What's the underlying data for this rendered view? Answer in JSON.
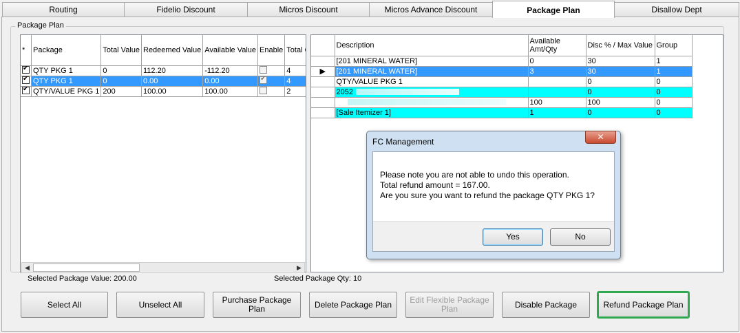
{
  "tabs": [
    {
      "label": "Routing"
    },
    {
      "label": "Fidelio Discount"
    },
    {
      "label": "Micros Discount"
    },
    {
      "label": "Micros Advance Discount"
    },
    {
      "label": "Package Plan"
    },
    {
      "label": "Disallow Dept"
    }
  ],
  "active_tab": "Package Plan",
  "groupbox_label": "Package Plan",
  "package_grid": {
    "headers": [
      "*",
      "Package",
      "Total Value",
      "Redeemed Value",
      "Available Value",
      "Enable",
      "Total Qty"
    ],
    "rows": [
      {
        "checked": true,
        "package": "QTY PKG 1",
        "total_value": "0",
        "redeemed_value": "112.20",
        "available_value": "-112.20",
        "enable": false,
        "total_qty": "4"
      },
      {
        "checked": true,
        "package": "QTY PKG 1",
        "total_value": "0",
        "redeemed_value": "0.00",
        "available_value": "0.00",
        "enable": true,
        "total_qty": "4"
      },
      {
        "checked": true,
        "package": "QTY/VALUE PKG 1",
        "total_value": "200",
        "redeemed_value": "100.00",
        "available_value": "100.00",
        "enable": false,
        "total_qty": "2"
      }
    ]
  },
  "detail_grid": {
    "headers": [
      "",
      "Description",
      "Available Amt/Qty",
      "Disc % / Max Value",
      "Group"
    ],
    "rows": [
      {
        "description": "[201 MINERAL WATER]",
        "available": "0",
        "disc": "30",
        "group": "1"
      },
      {
        "description": "[201 MINERAL WATER]",
        "available": "3",
        "disc": "30",
        "group": "1"
      },
      {
        "description": "QTY/VALUE PKG 1",
        "available": "",
        "disc": "0",
        "group": "0"
      },
      {
        "description": "2052",
        "available": "",
        "disc": "0",
        "group": "0"
      },
      {
        "description": "",
        "available": "100",
        "disc": "100",
        "group": "0"
      },
      {
        "description": "[Sale Itemizer 1]",
        "available": "1",
        "disc": "0",
        "group": "0"
      }
    ]
  },
  "selected_package_value": "Selected Package Value: 200.00",
  "selected_package_qty": "Selected Package Qty: 10",
  "buttons": {
    "select_all": "Select All",
    "unselect_all": "Unselect All",
    "purchase": "Purchase Package Plan",
    "delete": "Delete Package Plan",
    "edit_flexible": "Edit Flexible Package Plan",
    "disable": "Disable Package",
    "refund": "Refund Package Plan"
  },
  "dialog": {
    "title": "FC Management",
    "close_glyph": "✕",
    "line1": "Please note you are not able to undo this operation.",
    "line2": "Total refund amount = 167.00.",
    "line3": "Are you sure you want to refund the package QTY PKG 1?",
    "yes": "Yes",
    "no": "No"
  },
  "colors": {
    "selection": "#3399ff",
    "highlight_cyan": "#00ffff",
    "focus_green": "#2fa84f"
  }
}
